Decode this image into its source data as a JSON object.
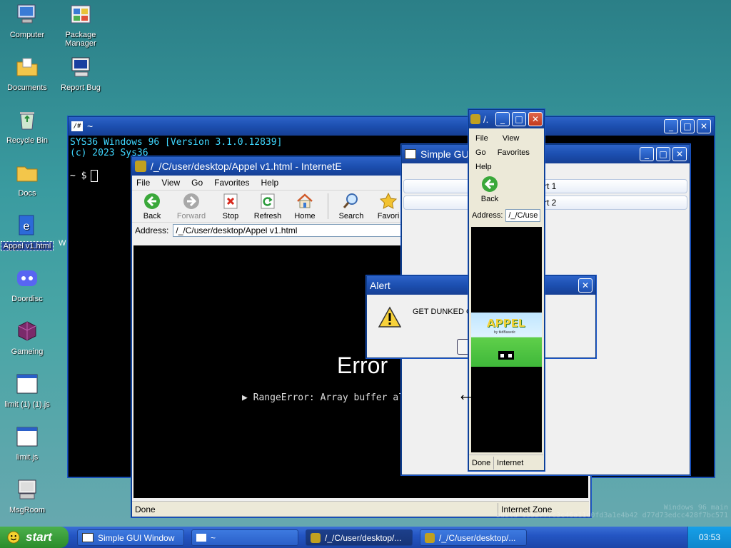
{
  "desktop": {
    "icons": [
      {
        "label": "Computer"
      },
      {
        "label": "Package Manager"
      },
      {
        "label": "Documents"
      },
      {
        "label": "Report Bug"
      },
      {
        "label": "Recycle Bin"
      },
      {
        "label": "Docs"
      },
      {
        "label": "Appel v1.html"
      },
      {
        "label": "Doordisc"
      },
      {
        "label": "Gameing"
      },
      {
        "label": "limit (1) (1).js"
      },
      {
        "label": "limit.js"
      },
      {
        "label": "MsgRoom"
      }
    ],
    "hidden_label": "W"
  },
  "terminal": {
    "title": "~",
    "line1": "SYS36 Windows 96 [Version 3.1.0.12839]",
    "line2": "(c) 2023 Sys36",
    "prompt": "~ $"
  },
  "ie_main": {
    "title": "/_/C/user/desktop/Appel v1.html - InternetE",
    "menu": [
      "File",
      "View",
      "Go",
      "Favorites",
      "Help"
    ],
    "toolbar": {
      "back": "Back",
      "forward": "Forward",
      "stop": "Stop",
      "refresh": "Refresh",
      "home": "Home",
      "search": "Search",
      "favorites": "Favori"
    },
    "address_label": "Address:",
    "address_value": "/_/C/user/desktop/Appel v1.html",
    "error_title": "Error",
    "error_detail": "▶ RangeError: Array buffer all",
    "status_left": "Done",
    "status_zone": "Internet Zone"
  },
  "simple_gui": {
    "title": "Simple GUI",
    "row1": "rt 1",
    "row2": "rt 2"
  },
  "alert": {
    "title": "Alert",
    "message": "GET DUNKED ON"
  },
  "ie_small": {
    "title": "/.",
    "menu_row1": [
      "File",
      "View"
    ],
    "menu_row2": [
      "Go",
      "Favorites"
    ],
    "menu_row3": [
      "Help"
    ],
    "back_label": "Back",
    "address_label": "Address:",
    "address_value": "/_/C/use",
    "game_logo": "APPEL",
    "game_byline": "by tkdBasedc",
    "status_left": "Done",
    "status_zone": "Internet"
  },
  "taskbar": {
    "start_label": "start",
    "tasks": [
      {
        "label": "Simple GUI Window"
      },
      {
        "label": "~"
      },
      {
        "label": "/_/C/user/desktop/..."
      },
      {
        "label": "/_/C/user/desktop/..."
      }
    ],
    "clock": "03:53"
  },
  "watermark": {
    "line1": "Windows 96 main",
    "line2": "build 1352777c3c46a11c0fd3a1e4b42 d77d73edcc428f7bc571"
  }
}
